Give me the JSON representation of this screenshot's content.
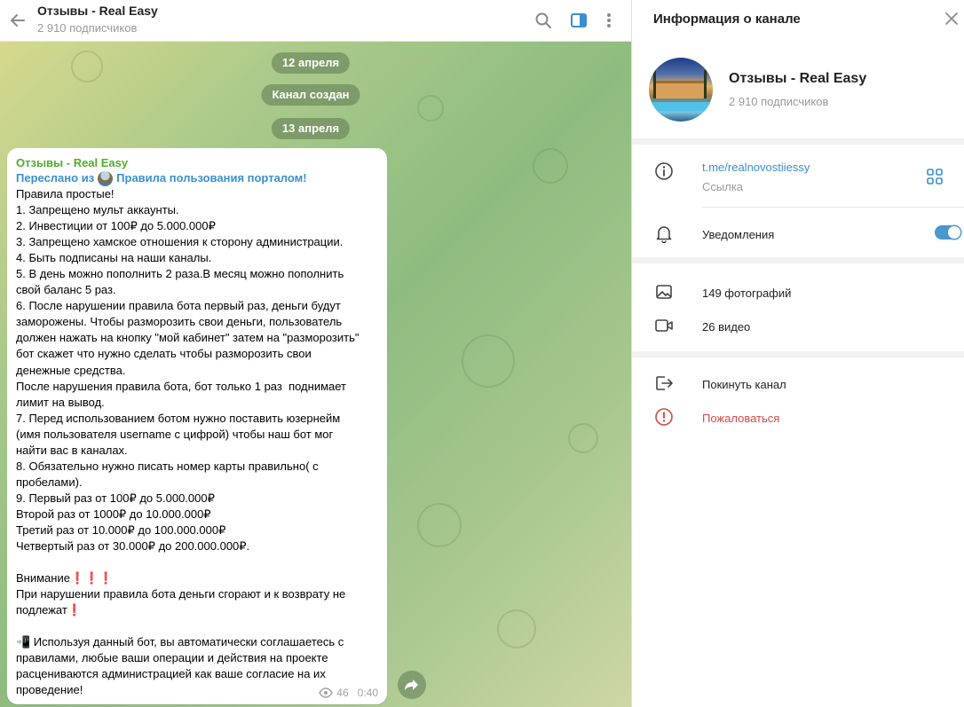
{
  "chat": {
    "title": "Отзывы - Real Easy",
    "subscribers": "2 910 подписчиков",
    "dates": [
      "12 апреля",
      "Канал создан",
      "13 апреля"
    ],
    "message": {
      "author": "Отзывы - Real Easy",
      "forwarded_prefix": "Переслано из",
      "forwarded_source": "Правила пользования порталом!",
      "lines": [
        "Правила простые!",
        "1. Запрещено мульт аккаунты.",
        "2. Инвестиции от 100₽ до 5.000.000₽",
        "3. Запрещено хамское отношения к сторону администрации.",
        "4. Быть подписаны на наши каналы.",
        "5. В день можно пополнить 2 раза.В месяц можно пополнить",
        "свой баланс 5 раз.",
        "6. После нарушении правила бота первый раз, деньги будут",
        "заморожены. Чтобы разморозить свои деньги, пользователь",
        "должен нажать на кнопку \"мой кабинет\" затем на \"разморозить\"",
        "бот скажет что нужно сделать чтобы разморозить свои",
        "денежные средства.",
        "После нарушения правила бота, бот только 1 раз  поднимает",
        "лимит на вывод.",
        "7. Перед использованием ботом нужно поставить юзернейм",
        "(имя пользователя username с цифрой) чтобы наш бот мог",
        "найти вас в каналах.",
        "8. Обязательно нужно писать номер карты правильно( с",
        "пробелами).",
        "9. Первый раз от 100₽ до 5.000.000₽",
        "Второй раз от 1000₽ до 10.000.000₽",
        "Третий раз от 10.000₽ до 100.000.000₽",
        "Четвертый раз от 30.000₽ до 200.000.000₽.",
        "",
        "Внимание❗️❗️❗️",
        "При нарушении правила бота деньги сгорают и к возврату не",
        "подлежат❗️",
        "",
        "📲 Используя данный бот, вы автоматически соглашаетесь с",
        "правилами, любые ваши операции и действия на проекте",
        "расцениваются администрацией как ваше согласие на их",
        "проведение!"
      ],
      "views": "46",
      "time": "0:40"
    }
  },
  "info": {
    "title": "Информация о канале",
    "channel_name": "Отзывы - Real Easy",
    "subscribers": "2 910 подписчиков",
    "link": "t.me/realnovostiiessy",
    "link_caption": "Ссылка",
    "notifications": "Уведомления",
    "notifications_on": true,
    "photos": "149 фотографий",
    "videos": "26 видео",
    "leave": "Покинуть канал",
    "report": "Пожаловаться"
  },
  "colors": {
    "accent": "#3a8fd1",
    "author": "#4fad2d",
    "danger": "#d14b47",
    "toggle": "#4a96d1"
  }
}
